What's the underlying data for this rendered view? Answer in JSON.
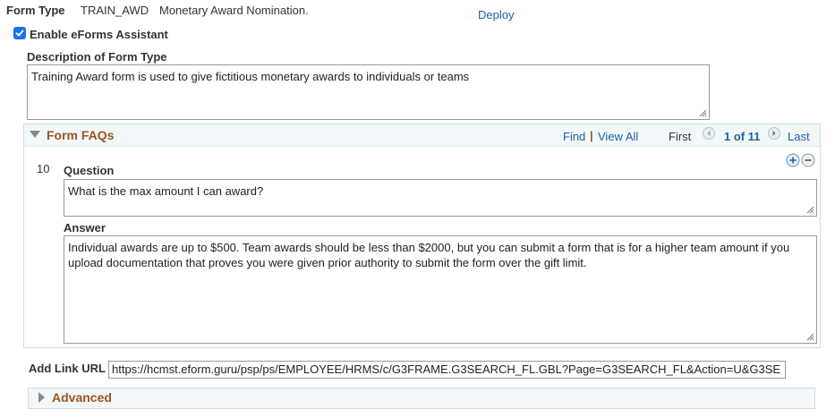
{
  "form_type": {
    "label": "Form Type",
    "code": "TRAIN_AWD",
    "description": "Monetary Award Nomination.",
    "deploy_label": "Deploy"
  },
  "eforms_assistant": {
    "label": "Enable eForms Assistant",
    "checked": true
  },
  "description_section": {
    "label": "Description of Form Type",
    "value": "Training Award form is used to give fictitious monetary awards to individuals or teams"
  },
  "faqs": {
    "title": "Form FAQs",
    "find_label": "Find",
    "separator": "|",
    "view_all_label": "View All",
    "first_label": "First",
    "page_status": "1 of 11",
    "last_label": "Last",
    "row_number": "10",
    "question_label": "Question",
    "question_value": "What is the max amount I can award?",
    "answer_label": "Answer",
    "answer_value": "Individual awards are up to $500. Team awards should be less than $2000, but you can submit a form that is for a higher team amount if you upload documentation that proves you were given prior authority to submit the form over the gift limit."
  },
  "add_link": {
    "label": "Add Link URL",
    "value": "https://hcmst.eform.guru/psp/ps/EMPLOYEE/HRMS/c/G3FRAME.G3SEARCH_FL.GBL?Page=G3SEARCH_FL&Action=U&G3SE"
  },
  "advanced": {
    "title": "Advanced"
  },
  "colors": {
    "accent_link": "#1f5fa5",
    "section_title": "#a0521d",
    "checkbox": "#1a73e8",
    "header_bg": "#f2f7f9"
  }
}
